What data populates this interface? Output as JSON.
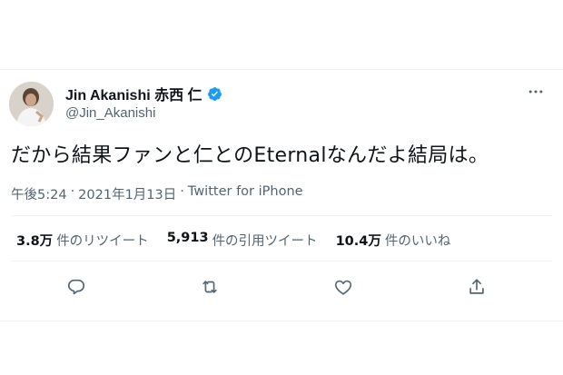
{
  "author": {
    "display_name": "Jin Akanishi 赤西 仁",
    "handle": "@Jin_Akanishi",
    "verified": true
  },
  "tweet": {
    "text": "だから結果ファンと仁とのEternalなんだよ結局は。",
    "time": "午後5:24",
    "separator": "·",
    "date": "2021年1月13日",
    "source": "Twitter for iPhone"
  },
  "stats": {
    "retweets": {
      "value": "3.8万",
      "label": "件のリツイート"
    },
    "quotes": {
      "value": "5,913",
      "label": "件の引用ツイート"
    },
    "likes": {
      "value": "10.4万",
      "label": "件のいいね"
    }
  },
  "icons": {
    "verified": "verified-badge-icon",
    "more": "more-dots-icon",
    "reply": "reply-icon",
    "retweet": "retweet-icon",
    "like": "heart-icon",
    "share": "share-icon"
  },
  "colors": {
    "text": "#0f1419",
    "secondary": "#536471",
    "verified": "#1d9bf0",
    "divider": "#eff3f4"
  }
}
